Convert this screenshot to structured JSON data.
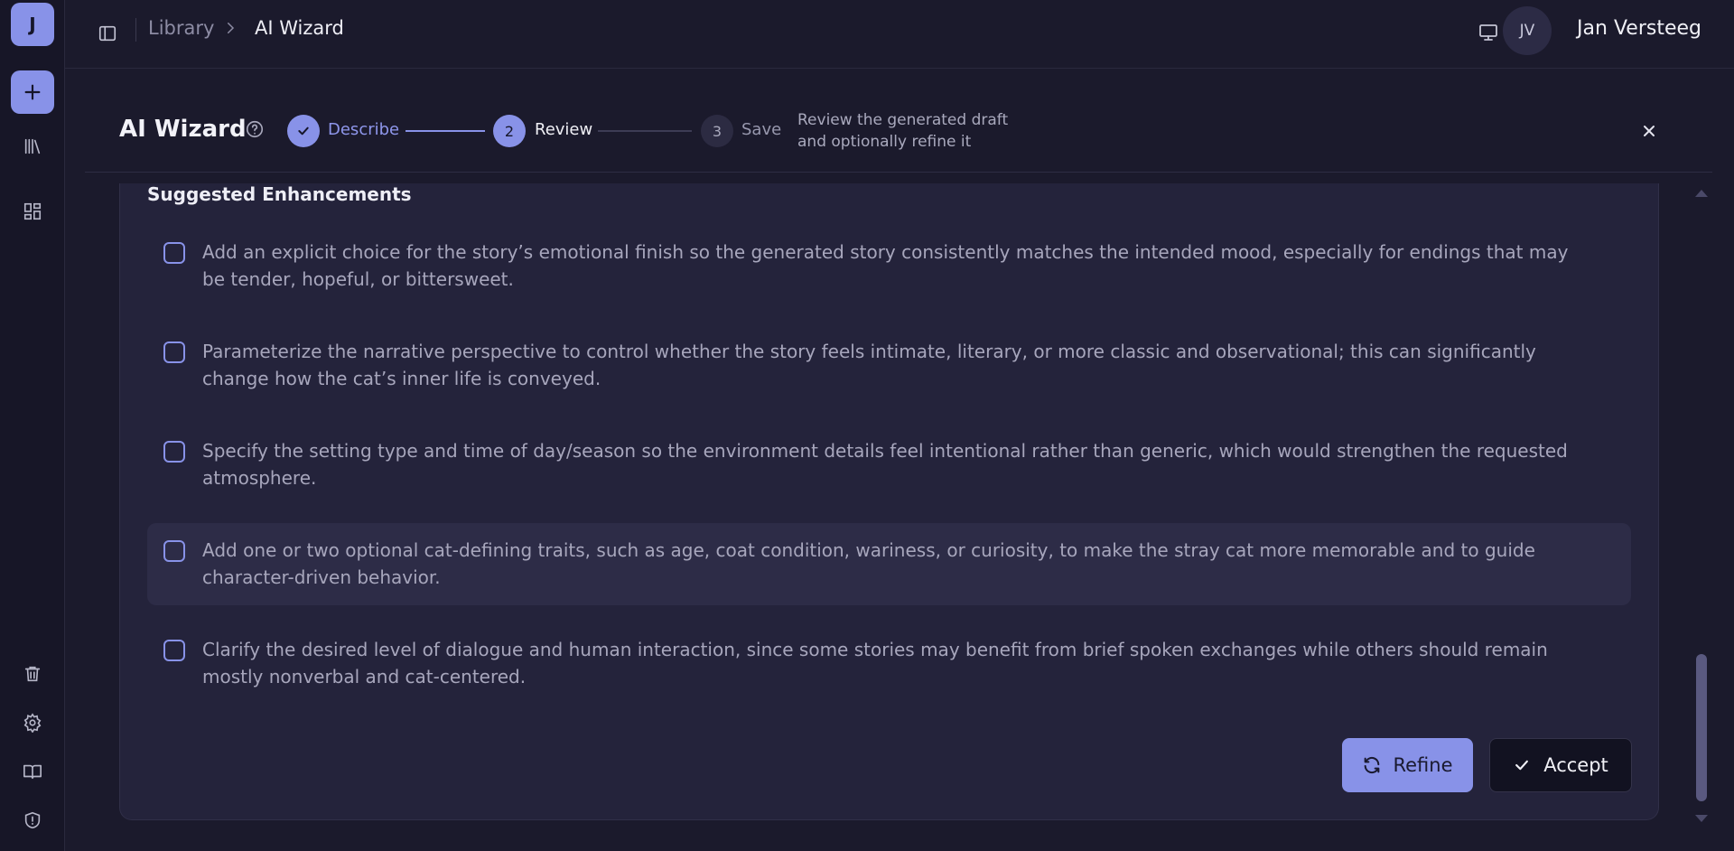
{
  "rail": {
    "avatar_initial": "J",
    "icons": [
      "plus-icon",
      "library-icon",
      "dashboard-icon",
      "trash-icon",
      "gear-icon",
      "book-icon",
      "shield-icon"
    ]
  },
  "topbar": {
    "breadcrumb_library": "Library",
    "breadcrumb_current": "AI Wizard",
    "user_initials": "JV",
    "user_name": "Jan Versteeg"
  },
  "wizard": {
    "title": "AI Wizard",
    "steps": [
      {
        "number": "1",
        "label": "Describe",
        "state": "done"
      },
      {
        "number": "2",
        "label": "Review",
        "state": "active"
      },
      {
        "number": "3",
        "label": "Save",
        "state": "pending"
      }
    ],
    "description_line1": "Review the generated draft",
    "description_line2": "and optionally refine it"
  },
  "enhancements": {
    "title": "Suggested Enhancements",
    "items": [
      {
        "text": "Add an explicit choice for the story’s emotional finish so the generated story consistently matches the intended mood, especially for endings that may be tender, hopeful, or bittersweet.",
        "checked": false
      },
      {
        "text": "Parameterize the narrative perspective to control whether the story feels intimate, literary, or more classic and observational; this can significantly change how the cat’s inner life is conveyed.",
        "checked": false
      },
      {
        "text": "Specify the setting type and time of day/season so the environment details feel intentional rather than generic, which would strengthen the requested atmosphere.",
        "checked": false
      },
      {
        "text": "Add one or two optional cat-defining traits, such as age, coat condition, wariness, or curiosity, to make the stray cat more memorable and to guide character-driven behavior.",
        "checked": false
      },
      {
        "text": "Clarify the desired level of dialogue and human interaction, since some stories may benefit from brief spoken exchanges while others should remain mostly nonverbal and cat-centered.",
        "checked": false
      }
    ]
  },
  "actions": {
    "refine_label": "Refine",
    "accept_label": "Accept"
  },
  "colors": {
    "accent": "#8892e8",
    "background": "#1b1a2c",
    "card": "#24233b"
  }
}
